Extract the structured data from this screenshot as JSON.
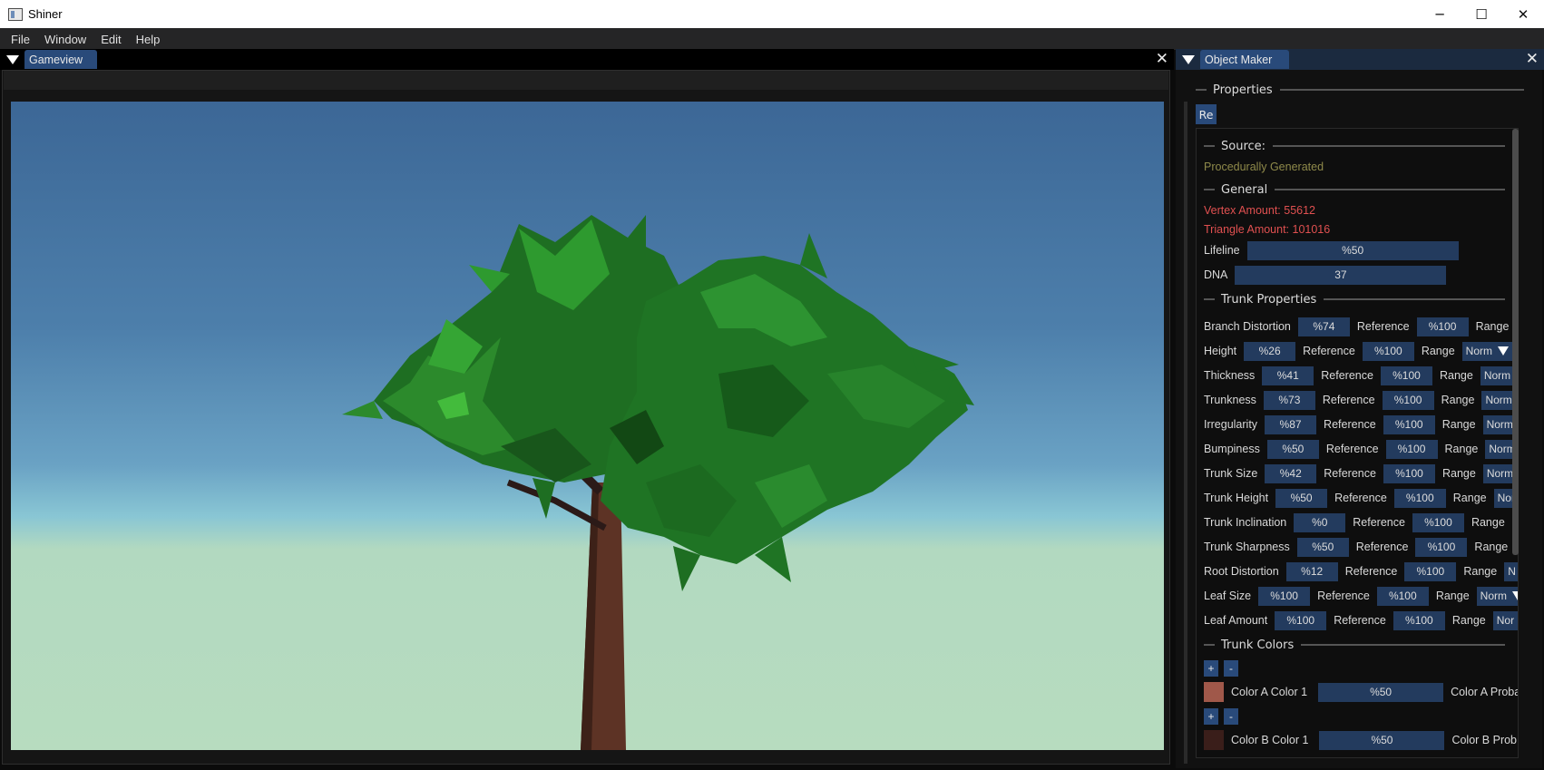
{
  "window": {
    "title": "Shiner",
    "minimize": "─",
    "maximize": "☐",
    "close": "✕"
  },
  "menu": [
    "File",
    "Window",
    "Edit",
    "Help"
  ],
  "gameview": {
    "tab": "Gameview",
    "close": "✕"
  },
  "object_maker": {
    "tab": "Object Maker",
    "close": "✕",
    "properties_header": "Properties",
    "re_button": "Re",
    "source_header": "Source:",
    "source_value": "Procedurally Generated",
    "general_header": "General",
    "vertex_amount": "Vertex Amount: 55612",
    "triangle_amount": "Triangle Amount: 101016",
    "lifeline_label": "Lifeline",
    "lifeline_value": "%50",
    "dna_label": "DNA",
    "dna_value": "37",
    "trunk_header": "Trunk Properties",
    "reference_label": "Reference",
    "range_label": "Range",
    "trunk_rows": [
      {
        "label": "Branch Distortion",
        "value": "%74",
        "ref": "%100",
        "drop": ""
      },
      {
        "label": "Height",
        "value": "%26",
        "ref": "%100",
        "drop": "Norm"
      },
      {
        "label": "Thickness",
        "value": "%41",
        "ref": "%100",
        "drop": "Norm"
      },
      {
        "label": "Trunkness",
        "value": "%73",
        "ref": "%100",
        "drop": "Norm"
      },
      {
        "label": "Irregularity",
        "value": "%87",
        "ref": "%100",
        "drop": "Norm"
      },
      {
        "label": "Bumpiness",
        "value": "%50",
        "ref": "%100",
        "drop": "Norm"
      },
      {
        "label": "Trunk Size",
        "value": "%42",
        "ref": "%100",
        "drop": "Norm"
      },
      {
        "label": "Trunk Height",
        "value": "%50",
        "ref": "%100",
        "drop": "Nor"
      },
      {
        "label": "Trunk Inclination",
        "value": "%0",
        "ref": "%100",
        "drop": ""
      },
      {
        "label": "Trunk Sharpness",
        "value": "%50",
        "ref": "%100",
        "drop": ""
      },
      {
        "label": "Root Distortion",
        "value": "%12",
        "ref": "%100",
        "drop": "N"
      },
      {
        "label": "Leaf Size",
        "value": "%100",
        "ref": "%100",
        "drop": "Norm"
      },
      {
        "label": "Leaf Amount",
        "value": "%100",
        "ref": "%100",
        "drop": "Nor"
      }
    ],
    "colors_header": "Trunk Colors",
    "plus": "+",
    "minus": "-",
    "color_a_label": "Color A Color 1",
    "color_a_value": "%50",
    "color_a_prob": "Color A Proba",
    "color_a_hex": "#a0584a",
    "color_b_label": "Color B Color 1",
    "color_b_value": "%50",
    "color_b_prob": "Color B Prob",
    "color_b_hex": "#3a1e1a"
  },
  "colors": {
    "accent": "#294a7a",
    "field": "#233b5e",
    "source_text": "#8f8a4a",
    "stat_text": "#e05050"
  }
}
